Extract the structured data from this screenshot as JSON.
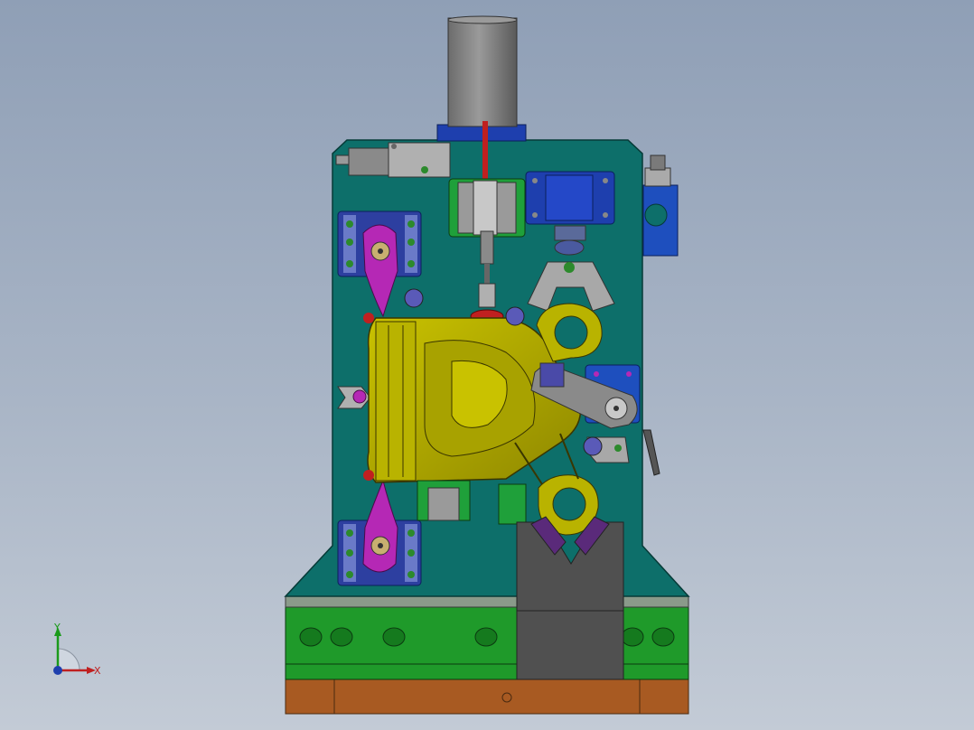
{
  "scene": {
    "description_icon": "fixture-assembly-icon"
  },
  "colors": {
    "background_top": "#8f9fb6",
    "background_bottom": "#c3cbd6",
    "plate": "#0d6f6a",
    "plate_edge": "#0a4f4b",
    "green_base": "#1f9a2a",
    "wood_base": "#a85a22",
    "yellow_part": "#b9b300",
    "magenta_clamp": "#b528b5",
    "blue_block": "#1e3fae",
    "dark_gray": "#505050",
    "light_gray": "#b9b9b9",
    "purple_ball": "#5a5ab8"
  },
  "triad": {
    "x_label": "X",
    "y_label": "Y"
  }
}
